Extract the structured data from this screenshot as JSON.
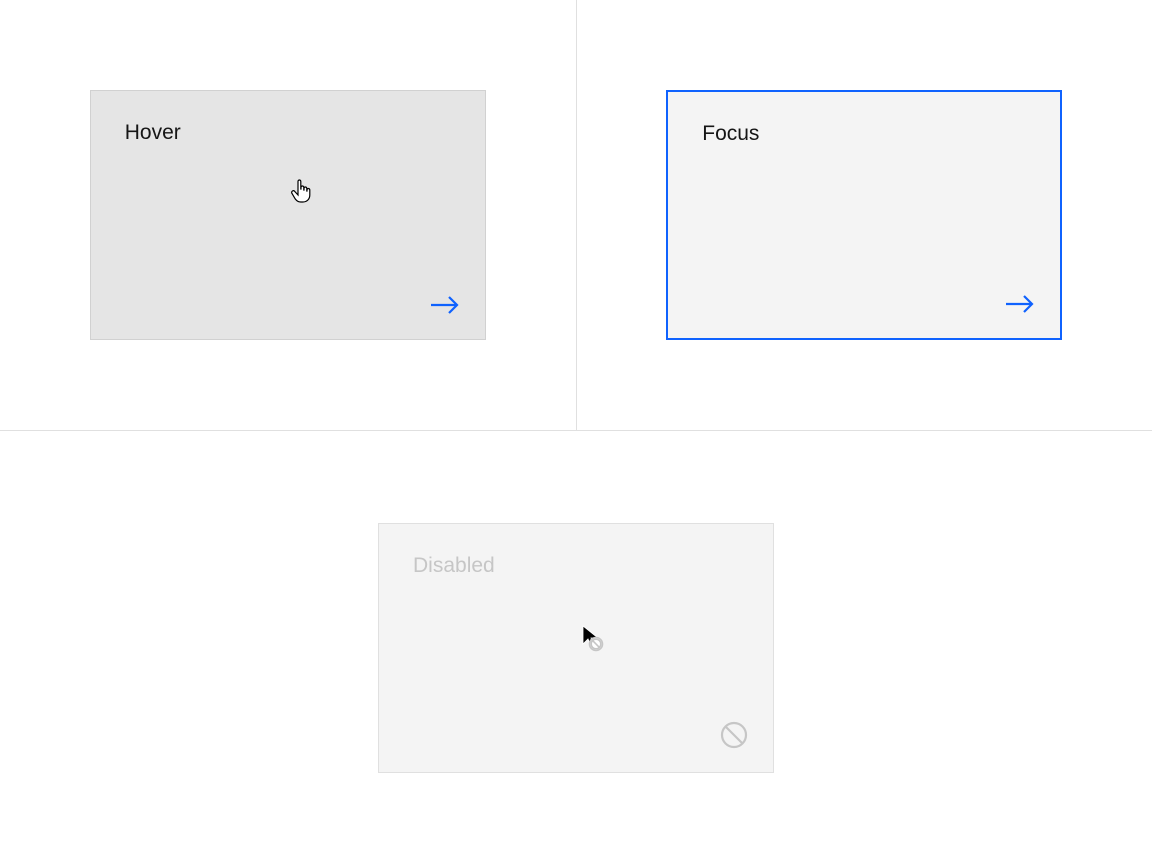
{
  "tiles": {
    "hover": {
      "label": "Hover"
    },
    "focus": {
      "label": "Focus"
    },
    "disabled": {
      "label": "Disabled"
    }
  },
  "colors": {
    "accent": "#0f62fe",
    "tile_hover_bg": "#e5e5e5",
    "tile_bg": "#f4f4f4",
    "disabled_text": "#c6c6c6",
    "disabled_icon": "#c6c6c6",
    "border": "#e0e0e0"
  }
}
